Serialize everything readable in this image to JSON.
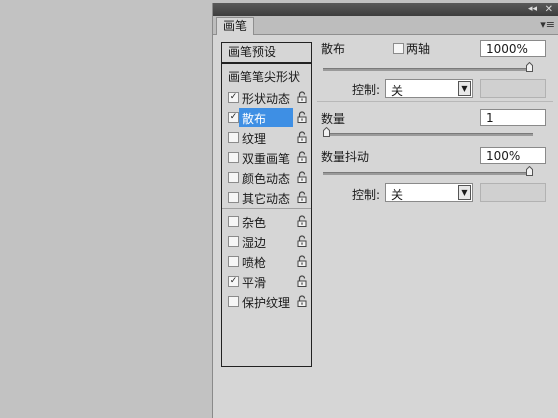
{
  "panel": {
    "tab_label": "画笔",
    "collapse_glyph": "◂◂",
    "close_glyph": "✕",
    "menu_glyph": "▾≡"
  },
  "sidebar": {
    "presets": "画笔预设",
    "tip_shape": "画笔笔尖形状",
    "items": [
      {
        "label": "形状动态",
        "checked": true,
        "selected": false,
        "check_glyph": "✓"
      },
      {
        "label": "散布",
        "checked": true,
        "selected": true,
        "check_glyph": "✓"
      },
      {
        "label": "纹理",
        "checked": false,
        "selected": false,
        "check_glyph": ""
      },
      {
        "label": "双重画笔",
        "checked": false,
        "selected": false,
        "check_glyph": ""
      },
      {
        "label": "颜色动态",
        "checked": false,
        "selected": false,
        "check_glyph": ""
      },
      {
        "label": "其它动态",
        "checked": false,
        "selected": false,
        "check_glyph": ""
      },
      {
        "label": "杂色",
        "checked": false,
        "selected": false,
        "check_glyph": ""
      },
      {
        "label": "湿边",
        "checked": false,
        "selected": false,
        "check_glyph": ""
      },
      {
        "label": "喷枪",
        "checked": false,
        "selected": false,
        "check_glyph": ""
      },
      {
        "label": "平滑",
        "checked": true,
        "selected": false,
        "check_glyph": "✓"
      },
      {
        "label": "保护纹理",
        "checked": false,
        "selected": false,
        "check_glyph": ""
      }
    ]
  },
  "scatter": {
    "label": "散布",
    "both_axes_label": "两轴",
    "both_axes_checked": false,
    "value": "1000%",
    "slider_fraction": 1.0,
    "control_label": "控制:",
    "control_value": "关"
  },
  "count": {
    "label": "数量",
    "value": "1",
    "slider_fraction": 0.0
  },
  "count_jitter": {
    "label": "数量抖动",
    "value": "100%",
    "slider_fraction": 1.0,
    "control_label": "控制:",
    "control_value": "关"
  },
  "colors": {
    "selection": "#3e8fe4",
    "panel_bg": "#d6d6d6",
    "desktop_bg": "#c2c2c2"
  }
}
